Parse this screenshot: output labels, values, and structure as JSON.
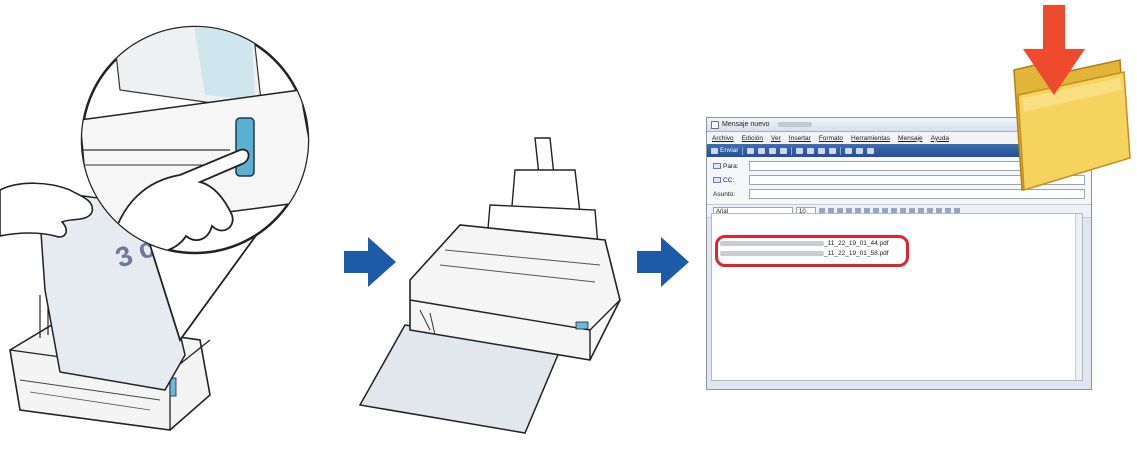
{
  "colors": {
    "flow_arrow": "#1d5aa8",
    "download_arrow": "#ee4a2e",
    "highlight": "#e2232a",
    "folder": "#f2c84b"
  },
  "email_client": {
    "window_title": "Mensaje nuevo",
    "menu": [
      "Archivo",
      "Edición",
      "Ver",
      "Insertar",
      "Formato",
      "Herramientas",
      "Mensaje",
      "Ayuda"
    ],
    "toolbar": {
      "send_label": "Enviar"
    },
    "fields": {
      "to_label": "Para:",
      "cc_label": "CC:",
      "subject_label": "Asunto:"
    },
    "format": {
      "font": "Arial",
      "size": "10"
    },
    "attachments": [
      "_11_22_19_01_44.pdf",
      "_11_22_19_01_58.pdf"
    ]
  },
  "icons": [
    "hand-feeding-paper",
    "scanner-scan-button",
    "scanner-output-paper",
    "right-arrow-icon",
    "folder-icon",
    "down-arrow-icon"
  ]
}
